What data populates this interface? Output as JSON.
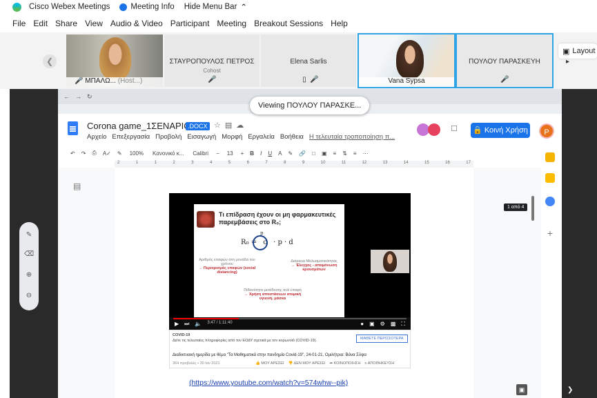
{
  "titlebar": {
    "app_name": "Cisco Webex Meetings",
    "meeting_info": "Meeting Info",
    "hide_menu": "Hide Menu Bar"
  },
  "menu": [
    "File",
    "Edit",
    "Share",
    "View",
    "Audio & Video",
    "Participant",
    "Meeting",
    "Breakout Sessions",
    "Help"
  ],
  "participants": [
    {
      "name": "ΜΠΑΛΩ...",
      "tag": "(Host...)"
    },
    {
      "name": "ΣΤΑΥΡΟΠΟΥΛΟΣ ΠΕΤΡΟΣ",
      "role": "Cohost"
    },
    {
      "name": "Elena Sarlis"
    },
    {
      "name": "Vana Sypsa"
    },
    {
      "name": "ΠΟΥΛΟΥ ΠΑΡΑΣΚΕΥΗ"
    }
  ],
  "layout_label": "Layout",
  "viewing_banner": "Viewing ΠΟΥΛΟΥ ΠΑΡΑΣΚΕ...",
  "doc": {
    "title": "Corona game_1ΣΕΝΑΡΙΟ",
    "badge": ".DOCX",
    "menu": [
      "Αρχείο",
      "Επεξεργασία",
      "Προβολή",
      "Εισαγωγή",
      "Μορφή",
      "Εργαλεία",
      "Βοήθεια"
    ],
    "last_edit": "Η τελευταία τροποποίηση π...",
    "share_button": "Κοινή Χρήση",
    "avatar": "P",
    "toolbar": {
      "zoom": "100%",
      "style": "Κανονικό κ...",
      "font": "Calibri",
      "size": "13"
    },
    "ruler": [
      "2",
      "1",
      "1",
      "2",
      "3",
      "4",
      "5",
      "6",
      "7",
      "8",
      "9",
      "10",
      "11",
      "12",
      "13",
      "14",
      "15",
      "16",
      "17"
    ],
    "page_count": "1 από 4",
    "link": "(https://www.youtube.com/watch?v=574whw--pik)"
  },
  "video": {
    "slide_question": "Τι επίδραση έχουν οι μη φαρμακευτικές παρεμβάσεις στο R₀;",
    "formula_left": "R₀ =",
    "formula_c": "c",
    "formula_right": "· p · d",
    "formula_p_label": "p",
    "left_text": "Αριθμός επαφών στη μονάδα του χρόνου",
    "left_red": "→ Περιορισμός επαφών (social distancing)",
    "right_text": "Διάρκεια Μολυσματικότητας",
    "right_red": "→ Έλεγχος - απομόνωση κρουσμάτων",
    "bottom_text": "Πιθανότητα μετάδοσης ανά επαφή",
    "bottom_red": "→ Χρήση αποστάσεων ατομική υγιεινή, μάσκα",
    "time": "3:47 / 1:11:40",
    "progress": 0.28,
    "card_title": "COVID-19",
    "card_sub": "Δείτε τις τελευταίες πληροφορίες από τον ΕΟΔΥ σχετικά με τον κορωνοϊό (COVID-19).",
    "card_more": "ΜΑΘΕΤΕ ΠΕΡΙΣΣΟΤΕΡΑ",
    "card_desc": "Διαδικτυακή ημερίδα με θέμα \"Τα Μαθηματικά στην πανδημία Covid-19\", 24-01-21, Ομιλήτρια: Βάνα Σύψα",
    "card_views": "364 προβολές • 30 Ιαν 2021",
    "card_actions": [
      "ΜΟΥ ΑΡΕΣΕΙ",
      "ΔΕΝ ΜΟΥ ΑΡΕΣΕΙ",
      "ΚΟΙΝΟΠΟΙΗΣΗ",
      "ΑΠΟΘΗΚΕΥΣΗ"
    ]
  },
  "colors": {
    "accent": "#1a73e8",
    "webex_blue": "#2ea3e6",
    "share_bg": "#2a2a2a"
  }
}
